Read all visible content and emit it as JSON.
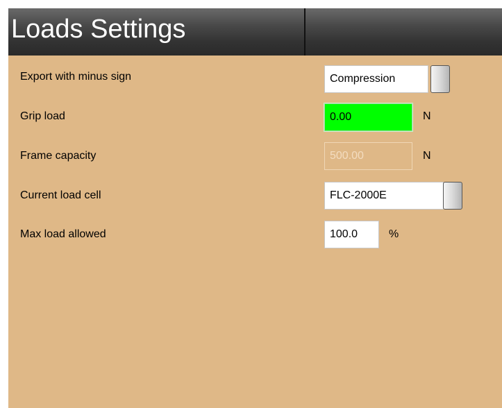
{
  "header": {
    "title": "Loads Settings"
  },
  "rows": {
    "export_minus_sign": {
      "label": "Export with minus sign",
      "value": "Compression"
    },
    "grip_load": {
      "label": "Grip load",
      "value": "0.00",
      "unit": "N",
      "highlight_color": "#00ff00"
    },
    "frame_capacity": {
      "label": "Frame capacity",
      "value": "500.00",
      "unit": "N",
      "disabled": true
    },
    "current_load_cell": {
      "label": "Current load cell",
      "value": "FLC-2000E"
    },
    "max_load_allowed": {
      "label": "Max load allowed",
      "value": "100.0",
      "unit": "%"
    }
  },
  "colors": {
    "panel_background": "#dfb887",
    "header_background": "#333333"
  }
}
